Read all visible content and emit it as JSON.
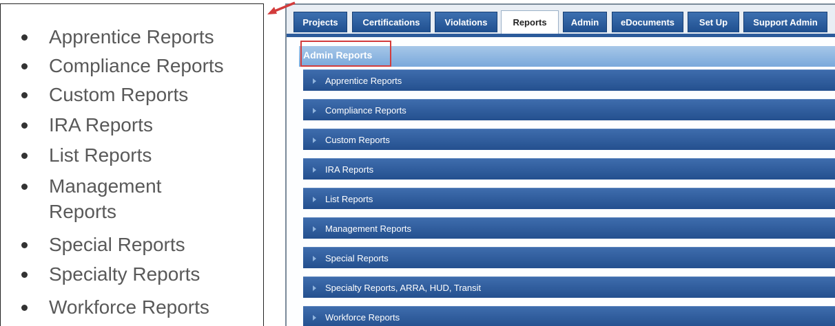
{
  "left_list": {
    "items": [
      {
        "label": "Apprentice Reports"
      },
      {
        "label": "Compliance Reports"
      },
      {
        "label": "Custom Reports"
      },
      {
        "label": "IRA Reports"
      },
      {
        "label": "List Reports"
      },
      {
        "label": "Management Reports",
        "line1": "Management",
        "line2": "Reports"
      },
      {
        "label": "Special Reports"
      },
      {
        "label": "Specialty Reports"
      },
      {
        "label": "Workforce Reports"
      }
    ]
  },
  "app": {
    "tabs": [
      {
        "label": "Projects",
        "active": false
      },
      {
        "label": "Certifications",
        "active": false
      },
      {
        "label": "Violations",
        "active": false
      },
      {
        "label": "Reports",
        "active": true
      },
      {
        "label": "Admin",
        "active": false
      },
      {
        "label": "eDocuments",
        "active": false
      },
      {
        "label": "Set Up",
        "active": false
      },
      {
        "label": "Support Admin",
        "active": false
      }
    ],
    "section_title": "Admin Reports",
    "reports": [
      {
        "label": "Apprentice Reports"
      },
      {
        "label": "Compliance Reports"
      },
      {
        "label": "Custom Reports"
      },
      {
        "label": "IRA Reports"
      },
      {
        "label": "List Reports"
      },
      {
        "label": "Management Reports"
      },
      {
        "label": "Special Reports"
      },
      {
        "label": "Specialty Reports, ARRA, HUD, Transit"
      },
      {
        "label": "Workforce Reports"
      }
    ]
  },
  "colors": {
    "highlight": "#d33c3c",
    "bar": "#2c5b9b",
    "header": "#7aa9db"
  }
}
